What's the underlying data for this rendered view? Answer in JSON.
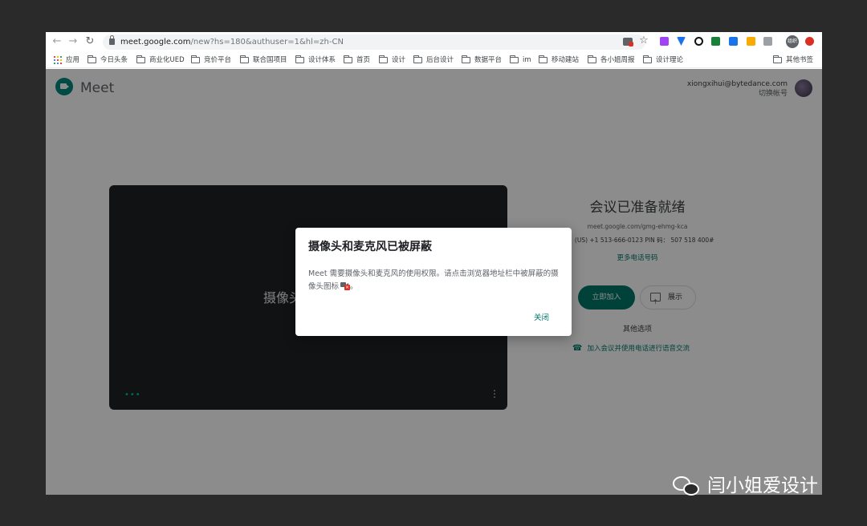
{
  "browser": {
    "back": "←",
    "forward": "→",
    "reload": "↻",
    "url_host": "meet.google.com",
    "url_path": "/new?hs=180&authuser=1&hl=zh-CN",
    "star": "☆",
    "profile_badge": "组织",
    "bookmarks": [
      "应用",
      "今日头条",
      "商业化UED",
      "竞价平台",
      "联合国项目",
      "设计体系",
      "首页",
      "设计",
      "后台设计",
      "数据平台",
      "im",
      "移动建站",
      "各小姐周报",
      "设计理论"
    ],
    "other_bookmarks": "其他书签"
  },
  "meet": {
    "product_name": "Meet",
    "account_email": "xiongxihui@bytedance.com",
    "switch_account": "切换帐号",
    "video_text": "摄像头",
    "video_dots": "•••",
    "video_menu": "⋮",
    "ready_title": "会议已准备就绪",
    "meeting_link": "meet.google.com/gmg-ehmg-kca",
    "dial_in": "码：  (US) +1 513-666-0123  PIN 码：  507 518 400#",
    "more_phone_numbers": "更多电话号码",
    "join_now": "立即加入",
    "present": "展示",
    "other_options": "其他选项",
    "phone_icon": "☎",
    "join_by_phone": "加入会议并使用电话进行语音交流"
  },
  "dialog": {
    "title": "摄像头和麦克风已被屏蔽",
    "body": "Meet 需要摄像头和麦克风的使用权限。请点击浏览器地址栏中被屏蔽的摄像头图标",
    "body_end": "。",
    "blocked_x": "×",
    "close": "关闭"
  },
  "watermark": {
    "text": "闫小姐爱设计"
  }
}
